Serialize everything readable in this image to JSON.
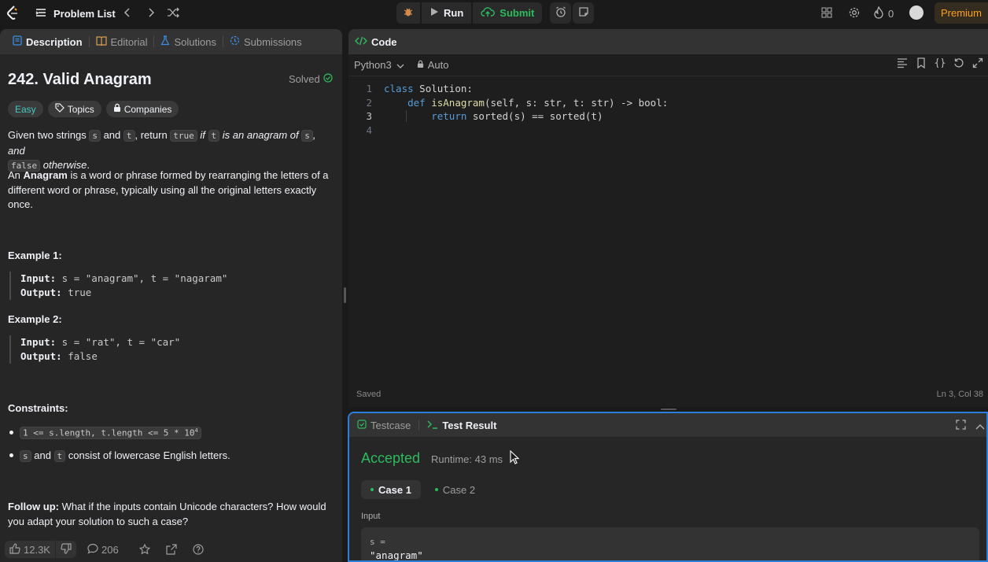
{
  "topbar": {
    "problem_list": "Problem List",
    "run": "Run",
    "submit": "Submit",
    "streak": "0",
    "premium": "Premium"
  },
  "left_tabs": [
    "Description",
    "Editorial",
    "Solutions",
    "Submissions"
  ],
  "problem": {
    "title": "242. Valid Anagram",
    "status": "Solved",
    "difficulty": "Easy",
    "topics": "Topics",
    "companies": "Companies",
    "desc1_a": "Given two strings ",
    "s": "s",
    "and": " and ",
    "t": "t",
    "desc1_b": ", return ",
    "true_code": "true",
    "if": " if ",
    "desc1_c": " is an anagram of ",
    "desc1_d": ", and",
    "false_code": "false",
    "otherwise": " otherwise",
    "period": ".",
    "desc2_a": "An ",
    "anagram_bold": "Anagram",
    "desc2_b": " is a word or phrase formed by rearranging the letters of a different word or phrase, typically using all the original letters exactly once.",
    "example1_title": "Example 1:",
    "example1_input_label": "Input:",
    "example1_input": " s = \"anagram\", t = \"nagaram\"",
    "example1_output_label": "Output:",
    "example1_output": " true",
    "example2_title": "Example 2:",
    "example2_input_label": "Input:",
    "example2_input": " s = \"rat\", t = \"car\"",
    "example2_output_label": "Output:",
    "example2_output": " false",
    "constraints_title": "Constraints:",
    "constraint1": "1 <= s.length, t.length <= 5 * 10",
    "constraint1_exp": "4",
    "constraint2_text": " consist of lowercase English letters.",
    "followup_label": "Follow up:",
    "followup_text": " What if the inputs contain Unicode characters? How would you adapt your solution to such a case?"
  },
  "footer": {
    "likes": "12.3K",
    "comments": "206"
  },
  "editor": {
    "tab": "Code",
    "language": "Python3",
    "mode": "Auto",
    "line_numbers": [
      "1",
      "2",
      "3",
      "4"
    ],
    "status": "Saved",
    "position": "Ln 3, Col 38",
    "code": {
      "l1_kw": "class",
      "l1_name": " Solution:",
      "l2_indent": "    ",
      "l2_kw": "def",
      "l2_fn": " isAnagram",
      "l2_rest": "(self, s: str, t: str) -> bool:",
      "l3_indent": "        ",
      "l3_kw": "return",
      "l3_rest": " sorted(s) == sorted(t)"
    }
  },
  "result": {
    "tab1": "Testcase",
    "tab2": "Test Result",
    "verdict": "Accepted",
    "runtime": "Runtime: 43 ms",
    "case1": "Case 1",
    "case2": "Case 2",
    "input_label": "Input",
    "var_label": "s =",
    "var_value": "\"anagram\""
  },
  "colors": {
    "accent_orange": "#ffa116",
    "accepted_green": "#2cbb5d",
    "easy_teal": "#46c6c2",
    "focus_blue": "#2b7fd8"
  }
}
